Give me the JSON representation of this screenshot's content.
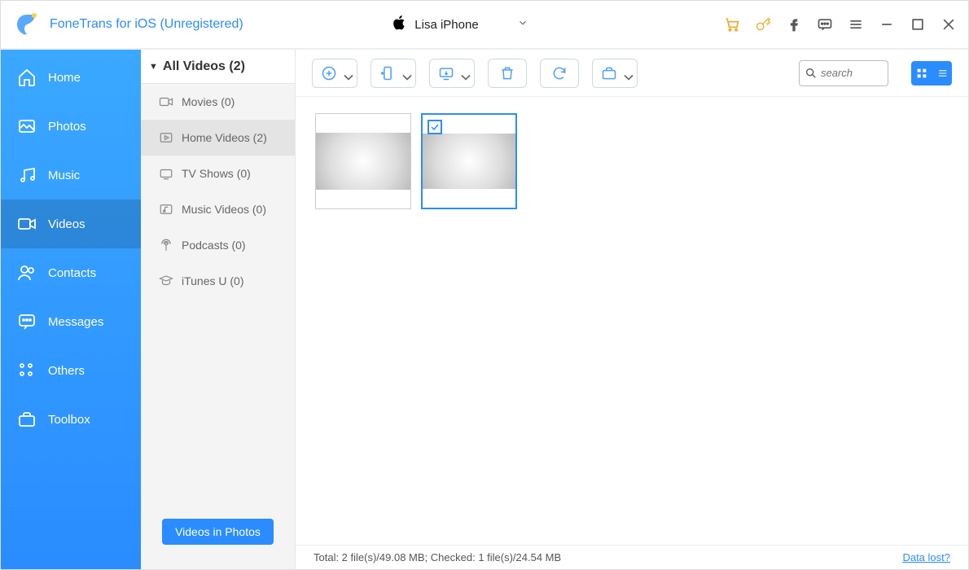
{
  "app_title": "FoneTrans for iOS (Unregistered)",
  "device": {
    "name": "Lisa iPhone"
  },
  "titlebar_icons": [
    "cart",
    "key",
    "facebook",
    "feedback",
    "menu",
    "minimize",
    "maximize",
    "close"
  ],
  "sidebar": {
    "items": [
      {
        "id": "home",
        "label": "Home"
      },
      {
        "id": "photos",
        "label": "Photos"
      },
      {
        "id": "music",
        "label": "Music"
      },
      {
        "id": "videos",
        "label": "Videos",
        "active": true
      },
      {
        "id": "contacts",
        "label": "Contacts"
      },
      {
        "id": "messages",
        "label": "Messages"
      },
      {
        "id": "others",
        "label": "Others"
      },
      {
        "id": "toolbox",
        "label": "Toolbox"
      }
    ]
  },
  "secondary": {
    "header": "All Videos (2)",
    "categories": [
      {
        "id": "movies",
        "label": "Movies (0)"
      },
      {
        "id": "home-videos",
        "label": "Home Videos (2)",
        "selected": true
      },
      {
        "id": "tv-shows",
        "label": "TV Shows (0)"
      },
      {
        "id": "music-videos",
        "label": "Music Videos (0)"
      },
      {
        "id": "podcasts",
        "label": "Podcasts (0)"
      },
      {
        "id": "itunes-u",
        "label": "iTunes U (0)"
      }
    ],
    "videos_in_photos": "Videos in Photos"
  },
  "toolbar": {
    "buttons": [
      "add",
      "to-device",
      "to-pc",
      "delete",
      "refresh",
      "folder"
    ],
    "search_placeholder": "search"
  },
  "grid": {
    "items": [
      {
        "id": "vid1",
        "selected": false
      },
      {
        "id": "vid2",
        "selected": true
      }
    ]
  },
  "status": {
    "text": "Total: 2 file(s)/49.08 MB; Checked: 1 file(s)/24.54 MB",
    "data_lost": "Data lost?"
  }
}
